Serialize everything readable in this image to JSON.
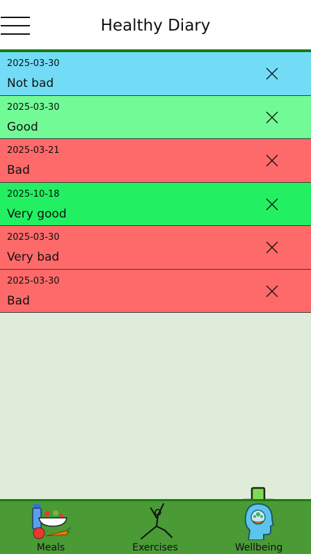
{
  "header": {
    "title": "Healthy Diary"
  },
  "entries": [
    {
      "date": "2025-03-30",
      "mood": "Not bad",
      "color": "#72dcf7"
    },
    {
      "date": "2025-03-30",
      "mood": "Good",
      "color": "#72fa96"
    },
    {
      "date": "2025-03-21",
      "mood": "Bad",
      "color": "#fe6a6a"
    },
    {
      "date": "2025-10-18",
      "mood": "Very good",
      "color": "#22f062"
    },
    {
      "date": "2025-03-30",
      "mood": "Very bad",
      "color": "#fe6a6a"
    },
    {
      "date": "2025-03-30",
      "mood": "Bad",
      "color": "#fe6a6a"
    }
  ],
  "nav": {
    "meals": "Meals",
    "exercises": "Exercises",
    "wellbeing": "Wellbeing"
  },
  "icons": {
    "menu": "hamburger-menu-icon",
    "delete": "close-icon",
    "add": "plus-icon",
    "meals": "healthy-food-icon",
    "exercises": "yoga-pose-icon",
    "wellbeing": "mind-head-icon"
  },
  "colors": {
    "accent": "#1a7a10",
    "nav_background": "#4a9a36",
    "content_background": "#dfecda",
    "add_button": "#7ed957"
  }
}
